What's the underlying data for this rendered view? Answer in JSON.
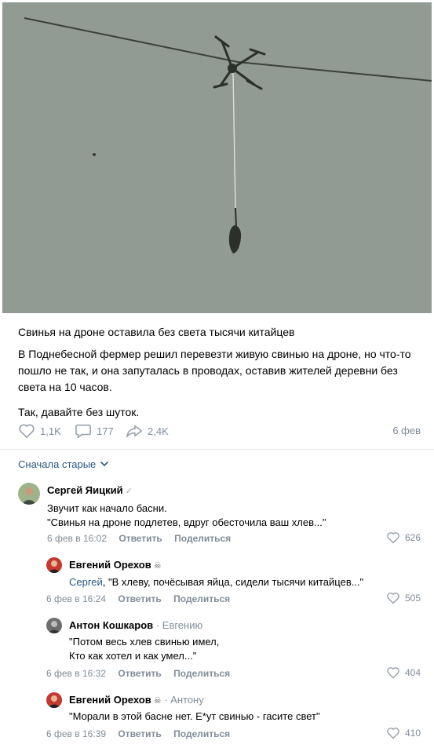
{
  "post": {
    "title": "Свинья на дроне оставила без света тысячи китайцев",
    "paragraph1": "В Поднебесной фермер решил перевезти живую свинью на дроне, но что-то пошло не так, и она запуталась в проводах, оставив жителей деревни без света на 10 часов.",
    "paragraph2": "Так, давайте без шуток.",
    "likes": "1,1K",
    "comments": "177",
    "shares": "2,4K",
    "date": "6 фев",
    "photo_bg_color": "#8f9791"
  },
  "sort": {
    "label": "Сначала старые"
  },
  "comments": [
    {
      "author": "Сергей Яицкий",
      "reply_to": "",
      "mention": "",
      "line1": "Звучит как начало басни.",
      "line2": "\"Свинья на дроне подлетев, вдруг обесточила ваш хлев...\"",
      "time": "6 фев в 16:02",
      "reply_label": "Ответить",
      "share_label": "Поделиться",
      "likes": "626"
    },
    {
      "author": "Евгений Орехов",
      "reply_to": "",
      "mention": "Сергей",
      "line1": ", \"В хлеву, почёсывая яйца, сидели тысячи китайцев...\"",
      "line2": "",
      "time": "6 фев в 16:24",
      "reply_label": "Ответить",
      "share_label": "Поделиться",
      "likes": "505"
    },
    {
      "author": "Антон Кошкаров",
      "reply_to": "Евгению",
      "mention": "",
      "line1": "\"Потом весь хлев свинью имел,",
      "line2": "Кто как хотел и как умел...\"",
      "time": "6 фев в 16:32",
      "reply_label": "Ответить",
      "share_label": "Поделиться",
      "likes": "404"
    },
    {
      "author": "Евгений Орехов",
      "reply_to": "Антону",
      "mention": "",
      "line1": "\"Морали в этой басне нет. Е*ут свинью - гасите свет\"",
      "line2": "",
      "time": "6 фев в 16:39",
      "reply_label": "Ответить",
      "share_label": "Поделиться",
      "likes": "410"
    }
  ],
  "icons": {
    "like": "heart-icon",
    "comment": "comment-icon",
    "share": "share-icon",
    "sort": "chevron-down-icon",
    "verified": "check-icon",
    "skull": "skull-icon"
  }
}
